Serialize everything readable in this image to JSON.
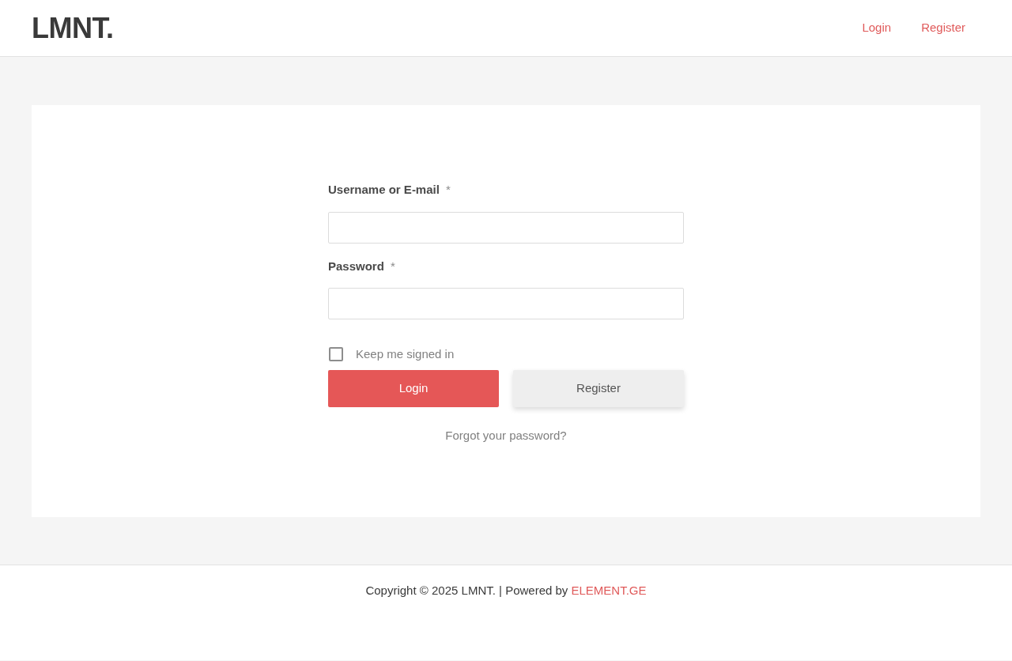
{
  "header": {
    "logo": "LMNT.",
    "nav": [
      {
        "label": "Login"
      },
      {
        "label": "Register"
      }
    ]
  },
  "login_form": {
    "fields": [
      {
        "label": "Username or E-mail",
        "required_mark": "*"
      },
      {
        "label": "Password",
        "required_mark": "*"
      }
    ],
    "remember": {
      "label": "Keep me signed in",
      "checked": false
    },
    "buttons": [
      {
        "label": "Login",
        "kind": "primary"
      },
      {
        "label": "Register",
        "kind": "secondary"
      }
    ],
    "forgot_link": "Forgot your password?"
  },
  "footer": {
    "text": "Copyright © 2025 LMNT. | Powered by",
    "link": "ELEMENT.GE"
  }
}
